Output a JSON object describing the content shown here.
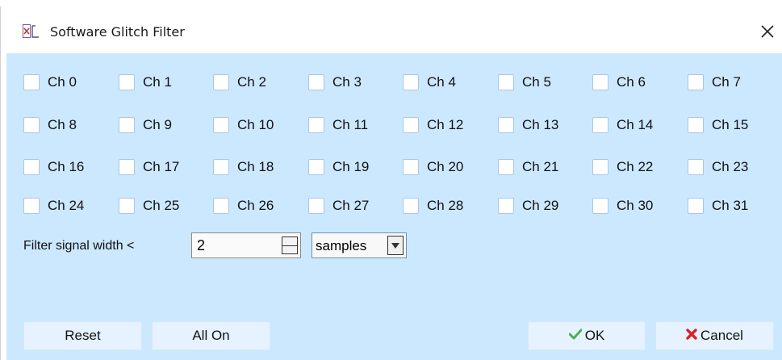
{
  "window": {
    "title": "Software Glitch Filter"
  },
  "channels": {
    "rows": [
      [
        "Ch 0",
        "Ch 1",
        "Ch 2",
        "Ch 3",
        "Ch 4",
        "Ch 5",
        "Ch 6",
        "Ch 7"
      ],
      [
        "Ch 8",
        "Ch 9",
        "Ch 10",
        "Ch 11",
        "Ch 12",
        "Ch 13",
        "Ch 14",
        "Ch 15"
      ],
      [
        "Ch 16",
        "Ch 17",
        "Ch 18",
        "Ch 19",
        "Ch 20",
        "Ch 21",
        "Ch 22",
        "Ch 23"
      ],
      [
        "Ch 24",
        "Ch 25",
        "Ch 26",
        "Ch 27",
        "Ch 28",
        "Ch 29",
        "Ch 30",
        "Ch 31"
      ]
    ],
    "checked": false
  },
  "filter": {
    "label": "Filter signal width <",
    "value": "2",
    "unit": "samples"
  },
  "buttons": {
    "reset": "Reset",
    "all_on": "All On",
    "ok": "OK",
    "cancel": "Cancel"
  },
  "colors": {
    "content_bg": "#cce8ff",
    "button_bg": "#e6f2ff",
    "ok_icon": "#4caf50",
    "cancel_icon": "#e02020",
    "app_icon": "#c0392b"
  },
  "icons": {
    "app": "glitch-filter-icon",
    "close": "close-icon",
    "ok": "checkmark-icon",
    "cancel": "x-icon",
    "dropdown": "chevron-down-icon"
  }
}
